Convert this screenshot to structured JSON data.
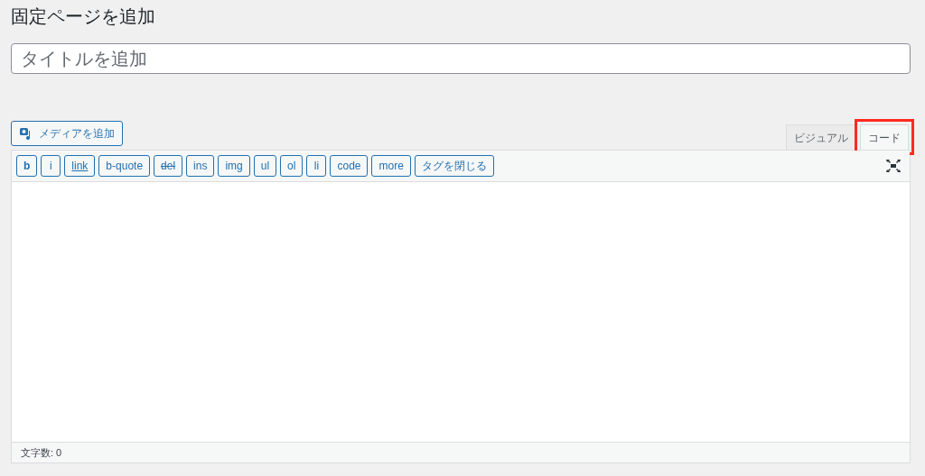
{
  "heading": "固定ページを追加",
  "title_field": {
    "placeholder": "タイトルを追加"
  },
  "media_button": {
    "label": "メディアを追加"
  },
  "tabs": [
    {
      "label": "ビジュアル",
      "selected": false,
      "highlighted": false
    },
    {
      "label": "コード",
      "selected": true,
      "highlighted": true
    }
  ],
  "quicktags": [
    {
      "label": "b",
      "kind": "bold"
    },
    {
      "label": "i",
      "kind": "plain"
    },
    {
      "label": "link",
      "kind": "underline"
    },
    {
      "label": "b-quote",
      "kind": "plain"
    },
    {
      "label": "del",
      "kind": "strike"
    },
    {
      "label": "ins",
      "kind": "plain"
    },
    {
      "label": "img",
      "kind": "plain"
    },
    {
      "label": "ul",
      "kind": "plain"
    },
    {
      "label": "ol",
      "kind": "plain"
    },
    {
      "label": "li",
      "kind": "plain"
    },
    {
      "label": "code",
      "kind": "plain"
    },
    {
      "label": "more",
      "kind": "plain"
    },
    {
      "label": "タグを閉じる",
      "kind": "plain"
    }
  ],
  "status_bar": {
    "word_count": "文字数: 0"
  }
}
